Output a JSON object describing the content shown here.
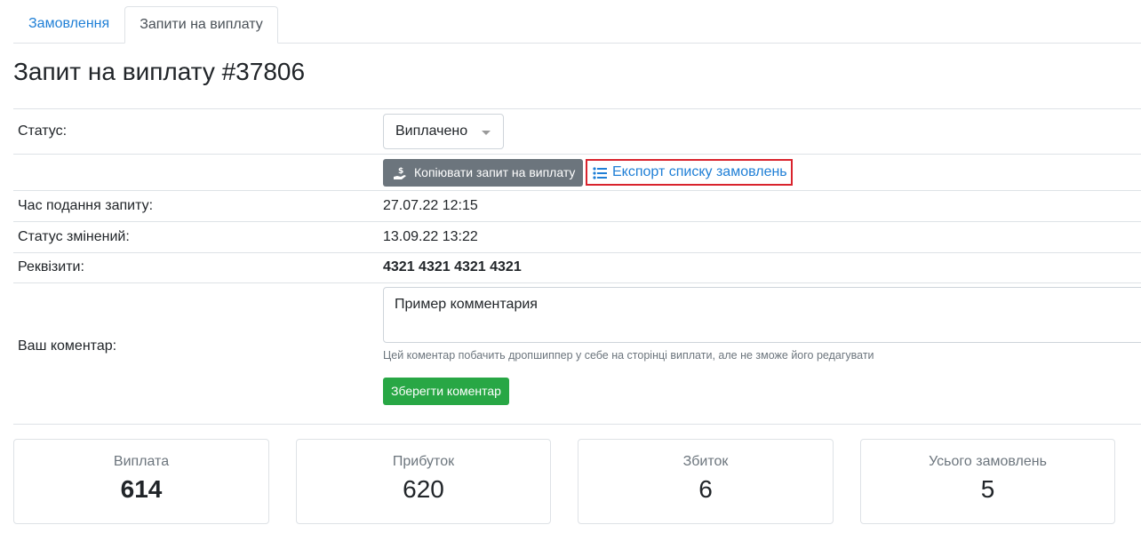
{
  "tabs": [
    {
      "label": "Замовлення",
      "active": false
    },
    {
      "label": "Запити на виплату",
      "active": true
    }
  ],
  "page_title": "Запит на виплату #37806",
  "details": {
    "status_label": "Статус:",
    "status_value": "Виплачено",
    "copy_button_label": "Копіювати запит на виплату",
    "export_link_label": "Експорт списку замовлень",
    "submitted_label": "Час подання запиту:",
    "submitted_value": "27.07.22 12:15",
    "changed_label": "Статус змінений:",
    "changed_value": "13.09.22 13:22",
    "requisites_label": "Реквізити:",
    "requisites_value": "4321 4321 4321 4321",
    "comment_label": "Ваш коментар:",
    "comment_value": "Пример комментария",
    "comment_help": "Цей коментар побачить дропшиппер у себе на сторінці виплати, але не зможе його редагувати",
    "save_button_label": "Зберегти коментар"
  },
  "stats": [
    {
      "label": "Виплата",
      "value": "614"
    },
    {
      "label": "Прибуток",
      "value": "620"
    },
    {
      "label": "Збиток",
      "value": "6"
    },
    {
      "label": "Усього замовлень",
      "value": "5"
    }
  ],
  "colors": {
    "link": "#1f7fd6",
    "secondary_button": "#6c757d",
    "success_button": "#28a745",
    "highlight_border": "#d9232d",
    "border": "#dee2e6"
  },
  "icons": {
    "copy_button": "hand-dollar-icon",
    "export_link": "list-icon",
    "status_select": "caret-down-icon"
  }
}
